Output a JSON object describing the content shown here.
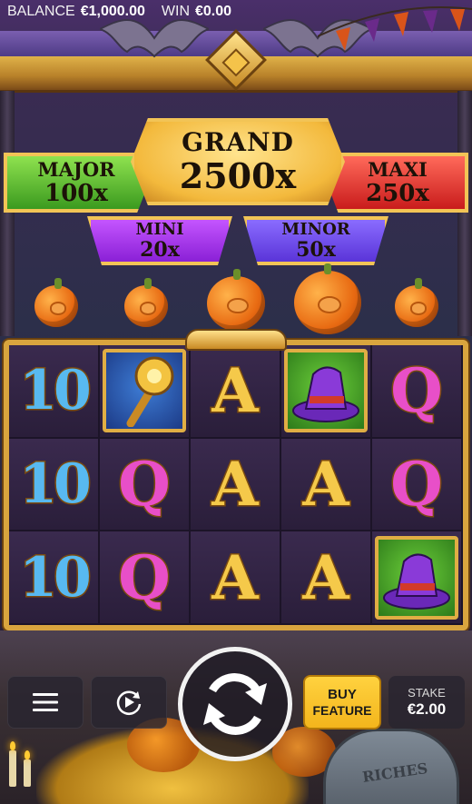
{
  "header": {
    "balance_label": "BALANCE",
    "balance_value": "€1,000.00",
    "win_label": "WIN",
    "win_value": "€0.00"
  },
  "jackpots": {
    "grand": {
      "name": "GRAND",
      "amount": "2500x"
    },
    "major": {
      "name": "MAJOR",
      "amount": "100x"
    },
    "maxi": {
      "name": "MAXI",
      "amount": "250x"
    },
    "mini": {
      "name": "MINI",
      "amount": "20x"
    },
    "minor": {
      "name": "MINOR",
      "amount": "50x"
    }
  },
  "reels": [
    [
      "10",
      "scepter-icon",
      "A",
      "hat-icon",
      "Q"
    ],
    [
      "10",
      "Q",
      "A",
      "A",
      "Q"
    ],
    [
      "10",
      "Q",
      "A",
      "A",
      "hat-icon"
    ]
  ],
  "reel_symbols": {
    "r0c0": "10",
    "r0c2": "A",
    "r0c4": "Q",
    "r1c0": "10",
    "r1c1": "Q",
    "r1c2": "A",
    "r1c3": "A",
    "r1c4": "Q",
    "r2c0": "10",
    "r2c1": "Q",
    "r2c2": "A",
    "r2c3": "A"
  },
  "controls": {
    "menu_icon": "hamburger-menu-icon",
    "autoplay_icon": "autoplay-icon",
    "spin_icon": "spin-arrows-icon",
    "buy_feature_line1": "BUY",
    "buy_feature_line2": "FEATURE",
    "stake_label": "STAKE",
    "stake_value": "€2.00"
  },
  "scenery": {
    "tombstone_text": "RICHES"
  },
  "colors": {
    "gold": "#f2c456",
    "buy_button": "#ffd23f",
    "grand": "#f3b93c",
    "major": "#3b9a1f",
    "maxi": "#c91c1c",
    "mini": "#8a20d6",
    "minor": "#5a34d8"
  }
}
